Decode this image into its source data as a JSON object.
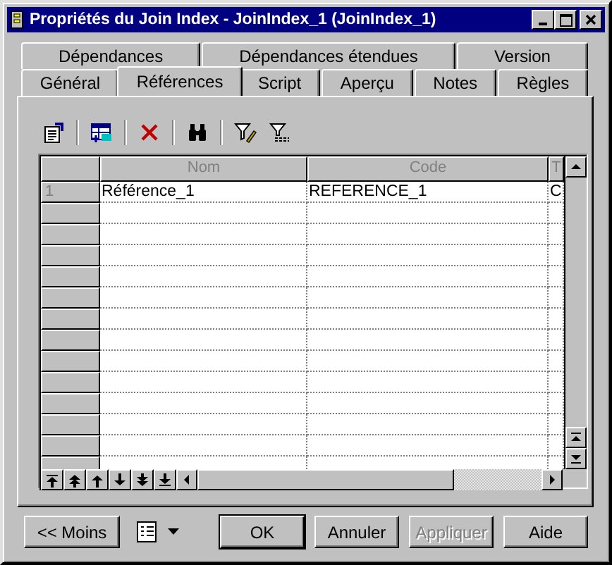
{
  "window": {
    "title": "Propriétés du Join Index - JoinIndex_1 (JoinIndex_1)"
  },
  "tab_rows": [
    [
      {
        "label": "Dépendances",
        "selected": false
      },
      {
        "label": "Dépendances étendues",
        "selected": false
      },
      {
        "label": "Version",
        "selected": false
      }
    ],
    [
      {
        "label": "Général",
        "selected": false
      },
      {
        "label": "Références",
        "selected": true
      },
      {
        "label": "Script",
        "selected": false
      },
      {
        "label": "Aperçu",
        "selected": false
      },
      {
        "label": "Notes",
        "selected": false
      },
      {
        "label": "Règles",
        "selected": false
      }
    ]
  ],
  "table": {
    "columns": [
      "Nom",
      "Code",
      "T"
    ],
    "rows": [
      {
        "number": "1",
        "cells": [
          "Référence_1",
          "REFERENCE_1",
          "C"
        ]
      }
    ]
  },
  "buttons": [
    {
      "label": "<< Moins",
      "kind": "left",
      "disabled": false,
      "default": false
    },
    {
      "label": "OK",
      "kind": "right",
      "disabled": false,
      "default": true
    },
    {
      "label": "Annuler",
      "kind": "right",
      "disabled": false,
      "default": false
    },
    {
      "label": "Appliquer",
      "kind": "right",
      "disabled": true,
      "default": false
    },
    {
      "label": "Aide",
      "kind": "right",
      "disabled": false,
      "default": false
    }
  ]
}
